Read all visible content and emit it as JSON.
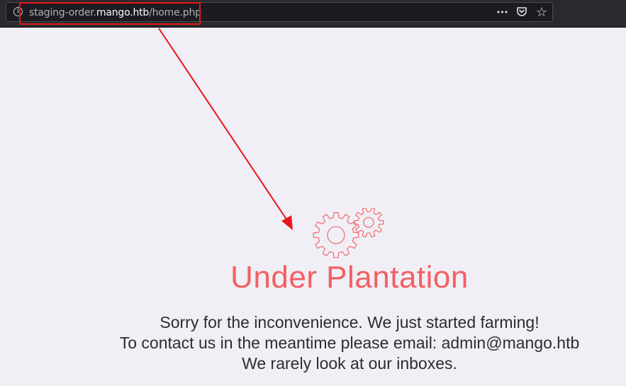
{
  "browser": {
    "url": {
      "subdomain": "staging-order.",
      "domain": "mango.htb",
      "path": "/home.php"
    },
    "actions": [
      {
        "name": "page-actions-icon",
        "glyph": "•••"
      },
      {
        "name": "pocket-icon",
        "glyph": "⛉"
      },
      {
        "name": "bookmark-star-icon",
        "glyph": "☆"
      }
    ]
  },
  "page": {
    "title": "Under Plantation",
    "lines": [
      "Sorry for the inconvenience. We just started farming!",
      "To contact us in the meantime please email: admin@mango.htb",
      "We rarely look at our inboxes."
    ]
  },
  "colors": {
    "accent": "#f35f63",
    "annotation": "#e8161a",
    "background": "#f0eff5",
    "chrome": "#2a2a2e"
  }
}
